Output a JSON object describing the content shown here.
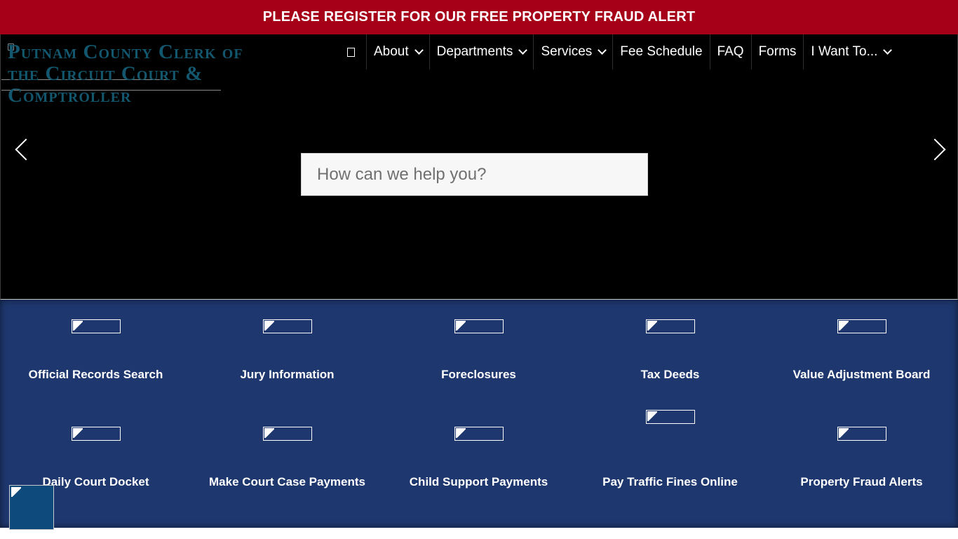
{
  "alert": {
    "text": "PLEASE REGISTER FOR OUR FREE PROPERTY FRAUD ALERT"
  },
  "header": {
    "logo_text": "Putnam County Clerk of the Circuit Court & Comptroller",
    "home_icon": "home-icon",
    "nav": [
      {
        "label": "About",
        "dropdown": true
      },
      {
        "label": "Departments",
        "dropdown": true
      },
      {
        "label": "Services",
        "dropdown": true
      },
      {
        "label": "Fee Schedule",
        "dropdown": false
      },
      {
        "label": "FAQ",
        "dropdown": false
      },
      {
        "label": "Forms",
        "dropdown": false
      },
      {
        "label": "I Want To...",
        "dropdown": true
      }
    ]
  },
  "hero": {
    "search_placeholder": "How can we help you?",
    "prev_icon": "chevron-left-icon",
    "next_icon": "chevron-right-icon"
  },
  "tiles": [
    {
      "label": "Official Records Search"
    },
    {
      "label": "Jury Information"
    },
    {
      "label": "Foreclosures"
    },
    {
      "label": "Tax Deeds"
    },
    {
      "label": "Value Adjustment Board"
    },
    {
      "label": "Daily Court Docket"
    },
    {
      "label": "Make Court Case Payments"
    },
    {
      "label": "Child Support Payments"
    },
    {
      "label": "Pay Traffic Fines Online"
    },
    {
      "label": "Property Fraud Alerts"
    }
  ],
  "colors": {
    "alert_bg": "#a50017",
    "hero_bg": "#000000",
    "tiles_bg": "#1e376e",
    "logo_text": "#12576e"
  }
}
